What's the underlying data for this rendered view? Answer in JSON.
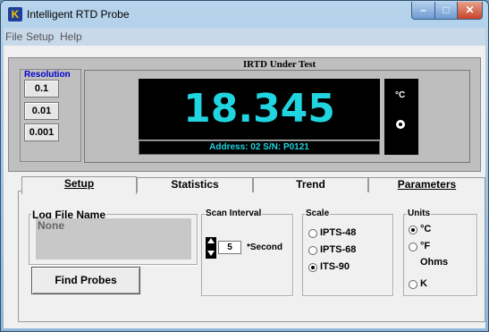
{
  "window": {
    "title": "Intelligent RTD Probe",
    "icon_letter": "K"
  },
  "menu": [
    "File",
    "Setup",
    "Help"
  ],
  "resolution": {
    "title": "Resolution",
    "options": [
      "0.1",
      "0.01",
      "0.001"
    ]
  },
  "display": {
    "title": "IRTD Under Test",
    "reading": "18.345",
    "address": "Address: 02  S/N: P0121",
    "unit": "°C"
  },
  "tabs": [
    "Setup",
    "Statistics",
    "Trend",
    "Parameters"
  ],
  "setup": {
    "log_title": "Log File Name",
    "log_value": "None",
    "find_button": "Find Probes",
    "scan_title": "Scan Interval",
    "scan_value": "5",
    "scan_unit": "*Second",
    "scale_title": "Scale",
    "scale_options": [
      "IPTS-48",
      "IPTS-68",
      "ITS-90"
    ],
    "scale_selected": "ITS-90",
    "units_title": "Units",
    "unit_options": [
      "°C",
      "°F",
      "Ohms",
      "K"
    ],
    "unit_selected": "°C"
  },
  "colors": {
    "display_text": "#20d4e0",
    "resolution_title": "#0000cc"
  }
}
